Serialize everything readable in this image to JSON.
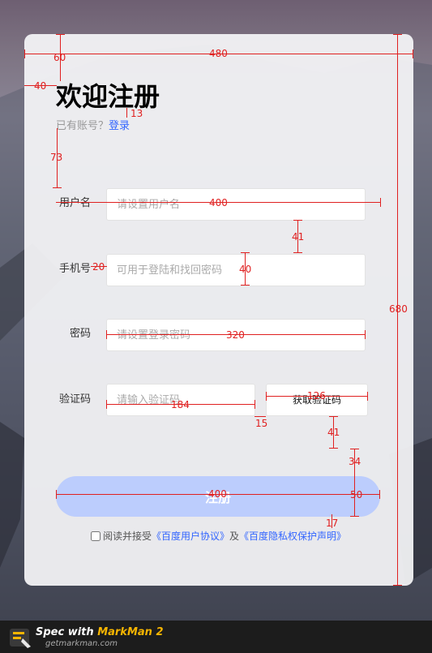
{
  "register": {
    "title": "欢迎注册",
    "have_account": "已有账号？",
    "login_link": "登录",
    "fields": {
      "username": {
        "label": "用户名",
        "placeholder": "请设置用户名"
      },
      "phone": {
        "label": "手机号",
        "placeholder": "可用于登陆和找回密码"
      },
      "password": {
        "label": "密码",
        "placeholder": "请设置登录密码"
      },
      "code": {
        "label": "验证码",
        "placeholder": "请输入验证码"
      }
    },
    "get_code_button": "获取验证码",
    "submit_button": "注册",
    "agreement": {
      "prefix": "阅读并接受",
      "link1": "《百度用户协议》",
      "conjunction": "及",
      "link2": "《百度隐私权保护声明》"
    }
  },
  "measurements": [
    "60",
    "480",
    "40",
    "13",
    "73",
    "400",
    "41",
    "20",
    "40",
    "320",
    "126",
    "184",
    "15",
    "41",
    "34",
    "400",
    "50",
    "17",
    "680"
  ],
  "footer": {
    "brand_prefix": "Spec with ",
    "brand_name": "MarkMan 2",
    "url": "getmarkman.com"
  },
  "colors": {
    "accent": "#3366ff",
    "submit_bg": "#bccdfd",
    "measure": "#e02020"
  }
}
